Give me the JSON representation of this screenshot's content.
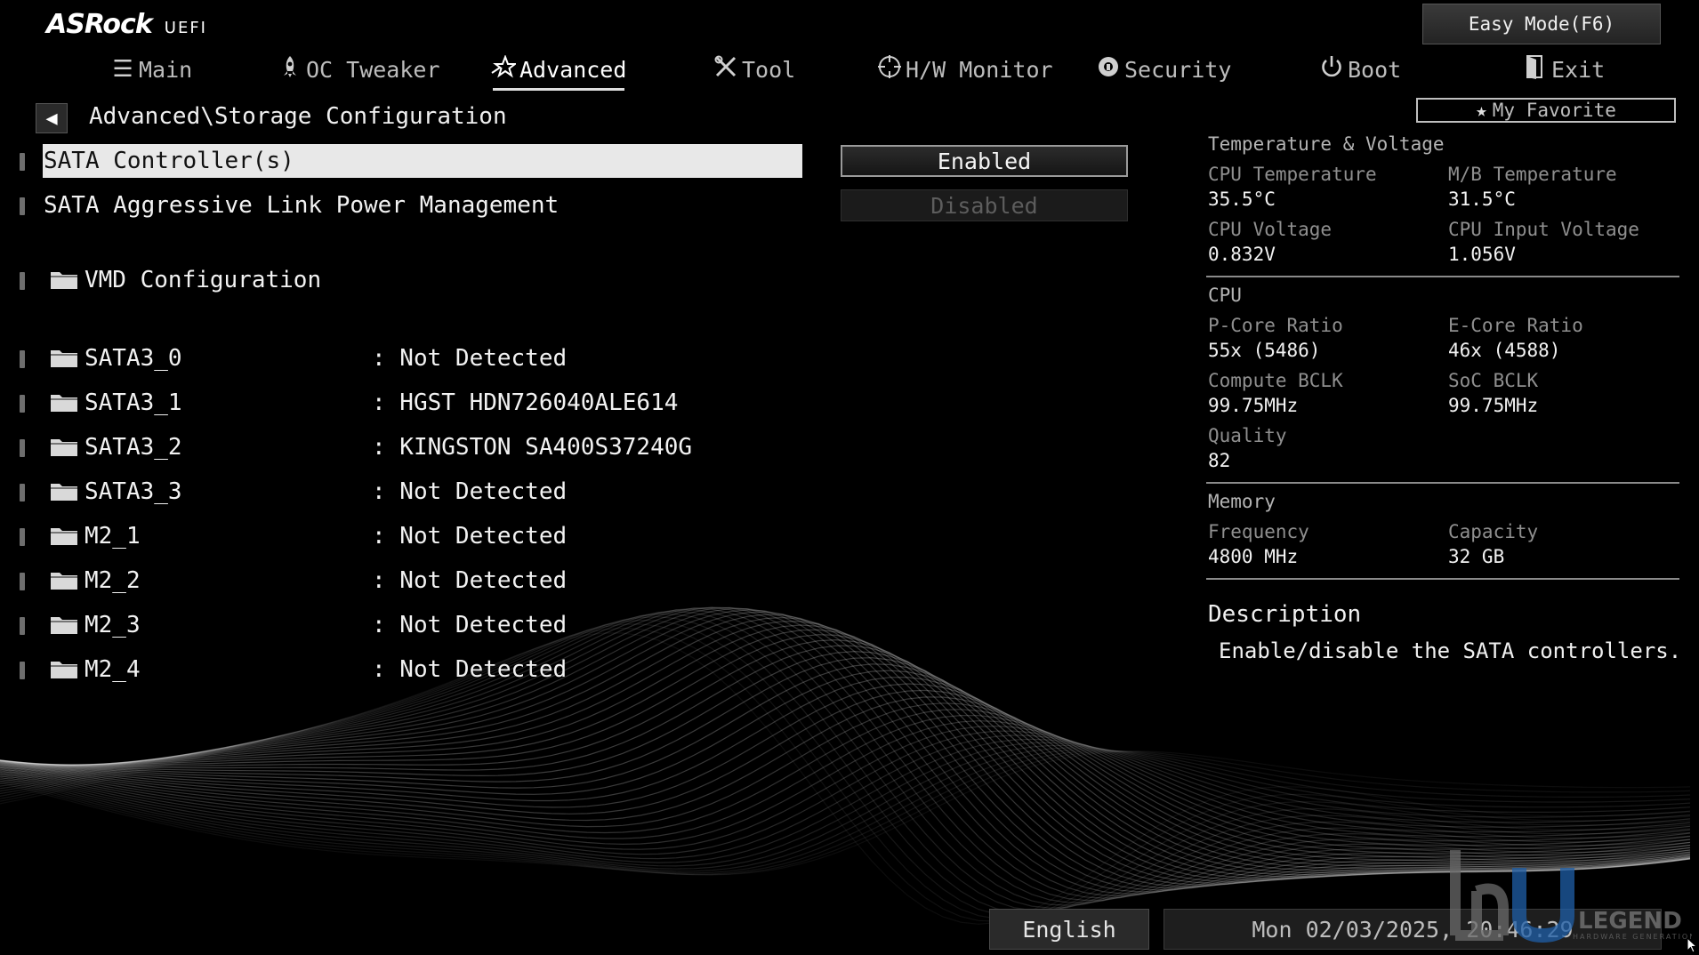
{
  "header": {
    "brand": "ASRock",
    "uefi": "UEFI",
    "easy_mode": "Easy Mode(F6)",
    "tabs": [
      {
        "label": "Main",
        "icon": "list-icon"
      },
      {
        "label": "OC Tweaker",
        "icon": "rocket-icon"
      },
      {
        "label": "Advanced",
        "icon": "star-icon"
      },
      {
        "label": "Tool",
        "icon": "wrench-icon"
      },
      {
        "label": "H/W Monitor",
        "icon": "crosshair-icon"
      },
      {
        "label": "Security",
        "icon": "shield-icon"
      },
      {
        "label": "Boot",
        "icon": "power-icon"
      },
      {
        "label": "Exit",
        "icon": "exit-door-icon"
      }
    ],
    "active_tab": "Advanced"
  },
  "breadcrumb": "Advanced\\Storage Configuration",
  "favorite": "My Favorite",
  "settings": {
    "sata_controllers": {
      "label": "SATA Controller(s)",
      "value": "Enabled"
    },
    "sata_alpm": {
      "label": "SATA Aggressive Link Power Management",
      "value": "Disabled"
    },
    "vmd": {
      "label": "VMD Configuration"
    }
  },
  "ports": [
    {
      "name": "SATA3_0",
      "value": ": Not Detected"
    },
    {
      "name": "SATA3_1",
      "value": ": HGST HDN726040ALE614"
    },
    {
      "name": "SATA3_2",
      "value": ": KINGSTON SA400S37240G"
    },
    {
      "name": "SATA3_3",
      "value": ": Not Detected"
    },
    {
      "name": "M2_1",
      "value": ": Not Detected"
    },
    {
      "name": "M2_2",
      "value": ": Not Detected"
    },
    {
      "name": "M2_3",
      "value": ": Not Detected"
    },
    {
      "name": "M2_4",
      "value": ": Not Detected"
    }
  ],
  "monitor": {
    "tv_title": "Temperature & Voltage",
    "cpu_temp_label": "CPU Temperature",
    "cpu_temp": "35.5°C",
    "mb_temp_label": "M/B Temperature",
    "mb_temp": "31.5°C",
    "cpu_volt_label": "CPU Voltage",
    "cpu_volt": "0.832V",
    "cpu_in_volt_label": "CPU Input Voltage",
    "cpu_in_volt": "1.056V",
    "cpu_title": "CPU",
    "pcore_label": "P-Core Ratio",
    "pcore": "55x (5486)",
    "ecore_label": "E-Core Ratio",
    "ecore": "46x (4588)",
    "compute_bclk_label": "Compute BCLK",
    "compute_bclk": "99.75MHz",
    "soc_bclk_label": "SoC BCLK",
    "soc_bclk": "99.75MHz",
    "quality_label": "Quality",
    "quality": "82",
    "mem_title": "Memory",
    "freq_label": "Frequency",
    "freq": "4800 MHz",
    "cap_label": "Capacity",
    "cap": "32 GB"
  },
  "description": {
    "title": "Description",
    "text": "Enable/disable the SATA controllers."
  },
  "footer": {
    "language": "English",
    "datetime": "Mon 02/03/2025, 20:46:29"
  },
  "watermark": {
    "text": "LEGEND",
    "sub": "HARDWARE GENERATION"
  },
  "colors": {
    "accent": "#e8e8e8",
    "background": "#000000",
    "dim": "#8f8f8f"
  }
}
